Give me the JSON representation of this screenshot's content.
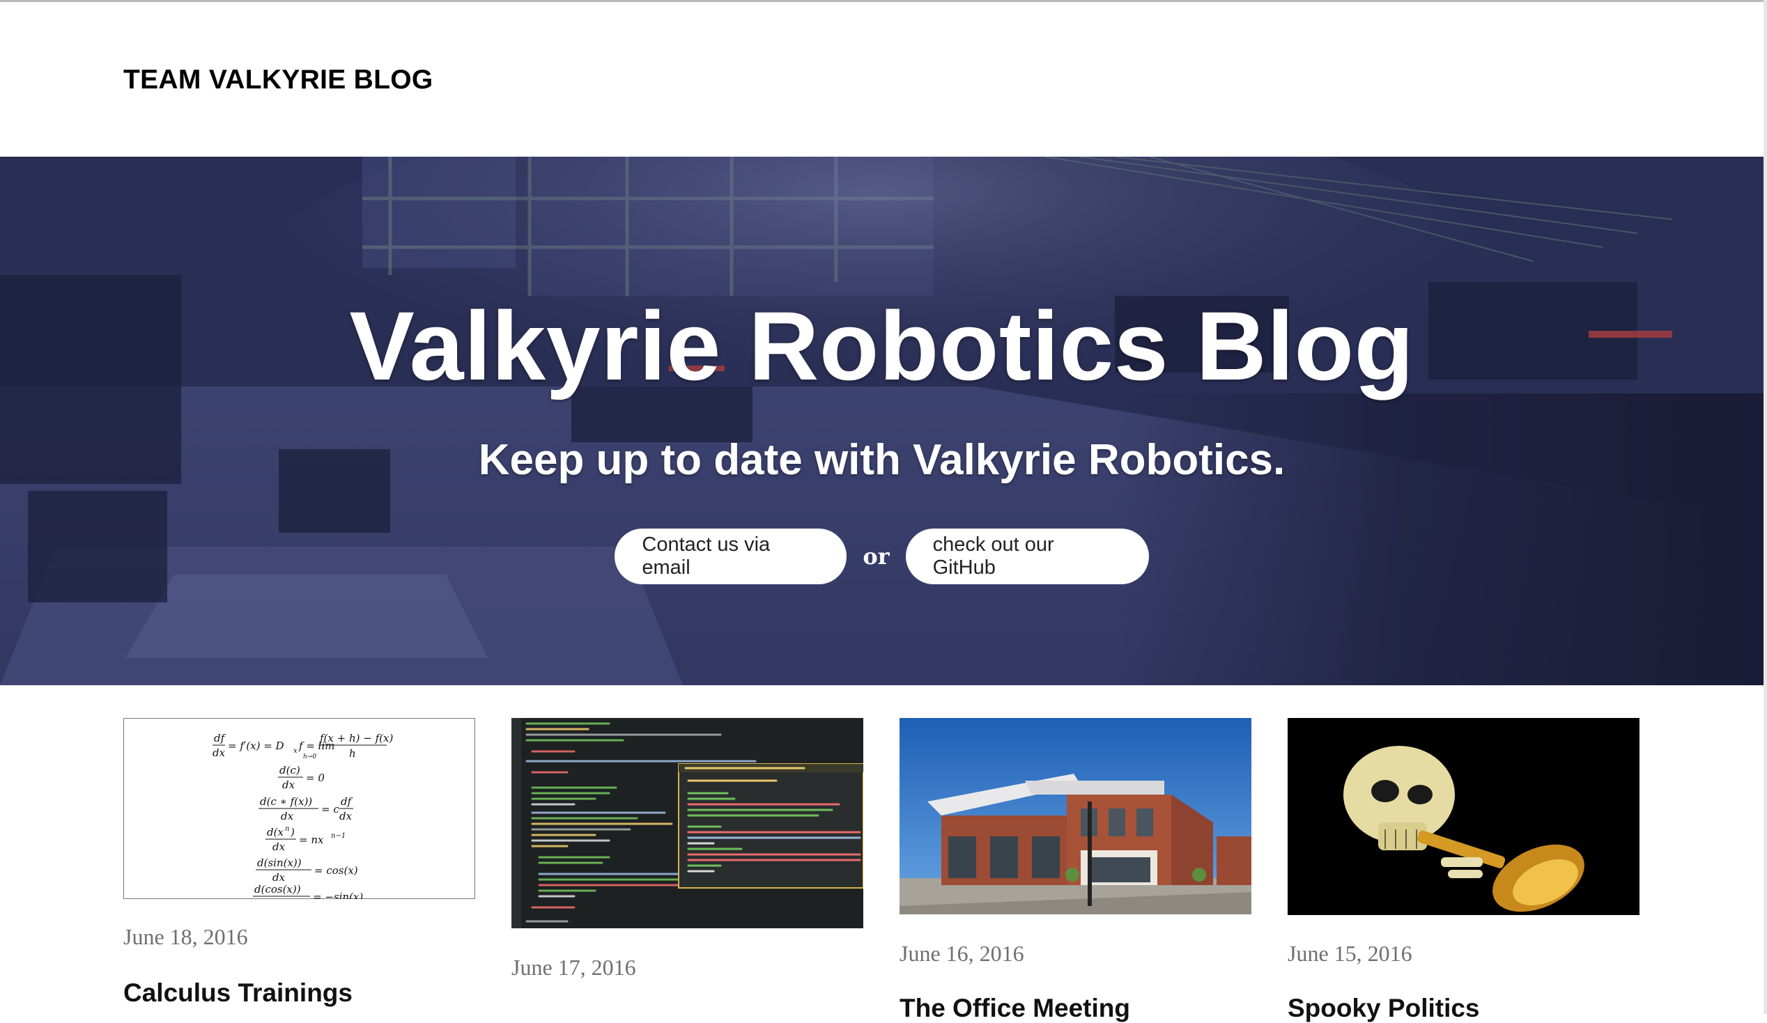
{
  "site": {
    "brand": "TEAM VALKYRIE BLOG"
  },
  "hero": {
    "title": "Valkyrie Robotics Blog",
    "subtitle": "Keep up to date with Valkyrie Robotics.",
    "email_button": "Contact us via email",
    "or_text": "or",
    "github_button": "check out our GitHub"
  },
  "posts": [
    {
      "date": "June 18, 2016",
      "title": "Calculus Trainings",
      "thumb_icon": "calculus-formulas-image"
    },
    {
      "date": "June 17, 2016",
      "title": "",
      "thumb_icon": "source-code-image"
    },
    {
      "date": "June 16, 2016",
      "title": "The Office Meeting",
      "thumb_icon": "office-building-image"
    },
    {
      "date": "June 15, 2016",
      "title": "Spooky Politics",
      "thumb_icon": "skull-trumpet-image"
    }
  ],
  "calc": {
    "l1a": "df",
    "l1b": "dx",
    "l1c": "= f′(x) = D",
    "l1d": "x",
    "l1e": "f = lim",
    "l1f": "h→0",
    "l1g": "f(x + h) − f(x)",
    "l1h": "h",
    "l2a": "d(c)",
    "l2b": "dx",
    "l2c": "= 0",
    "l3a": "d(c ∗ f(x))",
    "l3b": "dx",
    "l3c": "= c",
    "l3d": "df",
    "l3e": "dx",
    "l4a": "d(x",
    "l4b": "n",
    "l4c": ")",
    "l4d": "dx",
    "l4e": "= nx",
    "l4f": "n−1",
    "l5a": "d(sin(x))",
    "l5b": "dx",
    "l5c": "= cos(x)",
    "l6a": "d(cos(x))",
    "l6b": "= −sin(x)"
  },
  "colors": {
    "header_bg": "#ffffff",
    "brand_text": "#000000",
    "hero_overlay": "#2c3058",
    "date_text": "#6f6f6f",
    "title_text": "#111111"
  }
}
